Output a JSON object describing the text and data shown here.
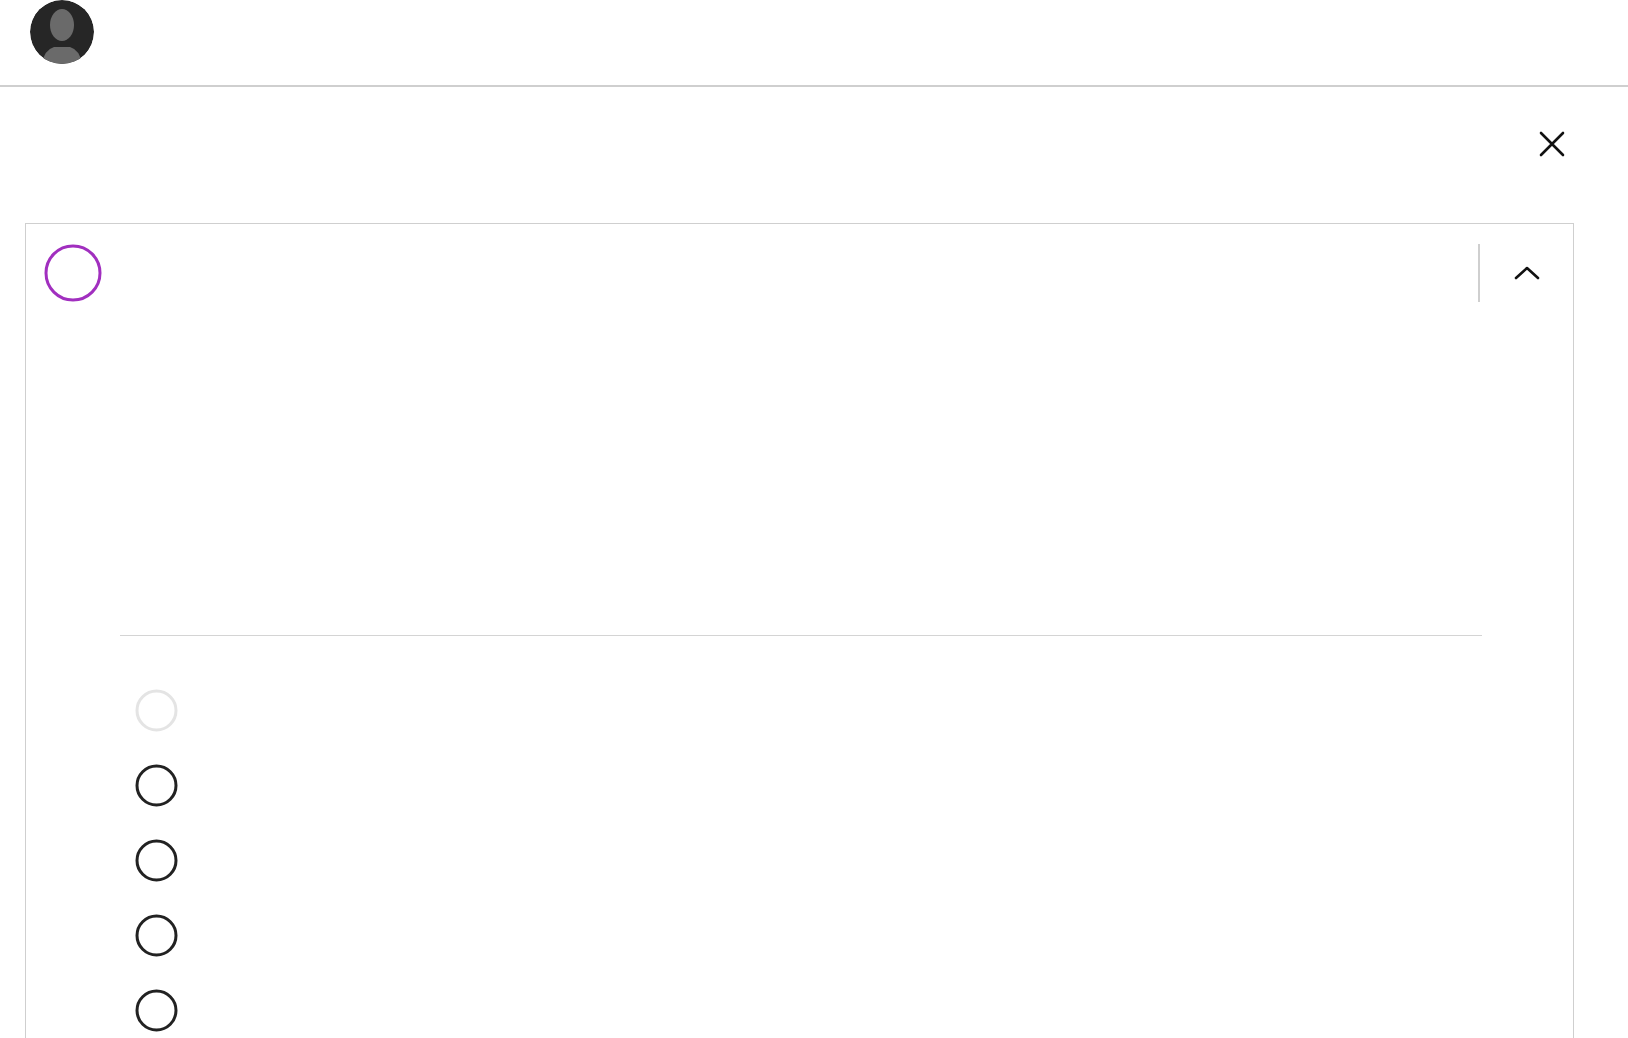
{
  "card": {
    "expanded": true
  },
  "options": [
    {
      "disabled": true,
      "selected": false
    },
    {
      "disabled": false,
      "selected": false
    },
    {
      "disabled": false,
      "selected": false
    },
    {
      "disabled": false,
      "selected": false
    },
    {
      "disabled": false,
      "selected": false
    }
  ]
}
